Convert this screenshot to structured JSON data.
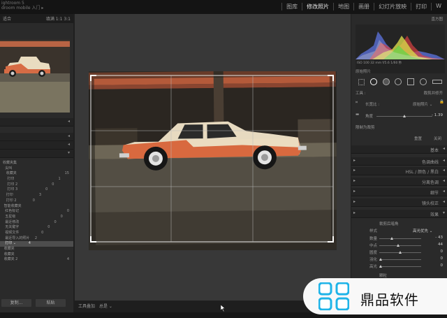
{
  "app": {
    "title_line1": "ightroom 5",
    "title_line2": "droom mobile 入门 ▸"
  },
  "modules": [
    "图库",
    "修改照片",
    "地图",
    "画册",
    "幻灯片放映",
    "打印",
    "W"
  ],
  "active_module": "修改照片",
  "left_panel": {
    "navigator_label": "适合",
    "navigator_opts": "填满  1:1  3:1",
    "collections": [
      "收藏夹集",
      "尖叫",
      "收藏夹",
      "打印",
      "打印 2",
      "打印 3",
      "打印",
      "打印 2",
      "智能收藏夹",
      "红色标记",
      "五星级",
      "最近修改",
      "无关键字",
      "视频文件",
      "最近导入的照片",
      "打印 ⌄",
      "收藏夹",
      "收藏夹",
      "收藏夹 2"
    ],
    "collection_counts": [
      "",
      "",
      "15",
      "1",
      "0",
      "0",
      "3",
      "0",
      "",
      "0",
      "0",
      "0",
      "0",
      "0",
      "2",
      "4",
      "",
      "",
      "4"
    ],
    "selected_index": 15,
    "buttons": {
      "copy": "复制...",
      "paste": "粘贴"
    }
  },
  "toolbar": {
    "label": "工具叠加",
    "value": "总是 ⌄"
  },
  "right_panel": {
    "histogram_label": "直方图",
    "hist_readout": "ISO 100   32 mm   f/5.6   1/60 秒",
    "original_photo": "原始照片",
    "tool_label": "工具 :",
    "tool_value": "裁剪并修齐",
    "aspect_label": "长宽比 :",
    "aspect_value": "原始照片 ⌄",
    "angle_label": "角度",
    "angle_value": "- 1.39",
    "constrain": "限制为裁剪",
    "reset": "重置",
    "close": "关闭",
    "sections": [
      "基本",
      "色调曲线",
      "HSL / 颜色 / 黑白",
      "分离色调",
      "细节",
      "镜头校正",
      "效果"
    ],
    "effects": {
      "title": "裁剪后暗角",
      "style_label": "样式",
      "style_value": "高光优先 ⌄",
      "sliders": [
        {
          "label": "数量",
          "value": "- 43"
        },
        {
          "label": "中点",
          "value": "44"
        },
        {
          "label": "圆度",
          "value": "0"
        },
        {
          "label": "羽化",
          "value": "0"
        },
        {
          "label": "高光",
          "value": "0"
        }
      ],
      "grain": "颗粒"
    }
  },
  "watermark": {
    "text": "鼎品软件"
  }
}
